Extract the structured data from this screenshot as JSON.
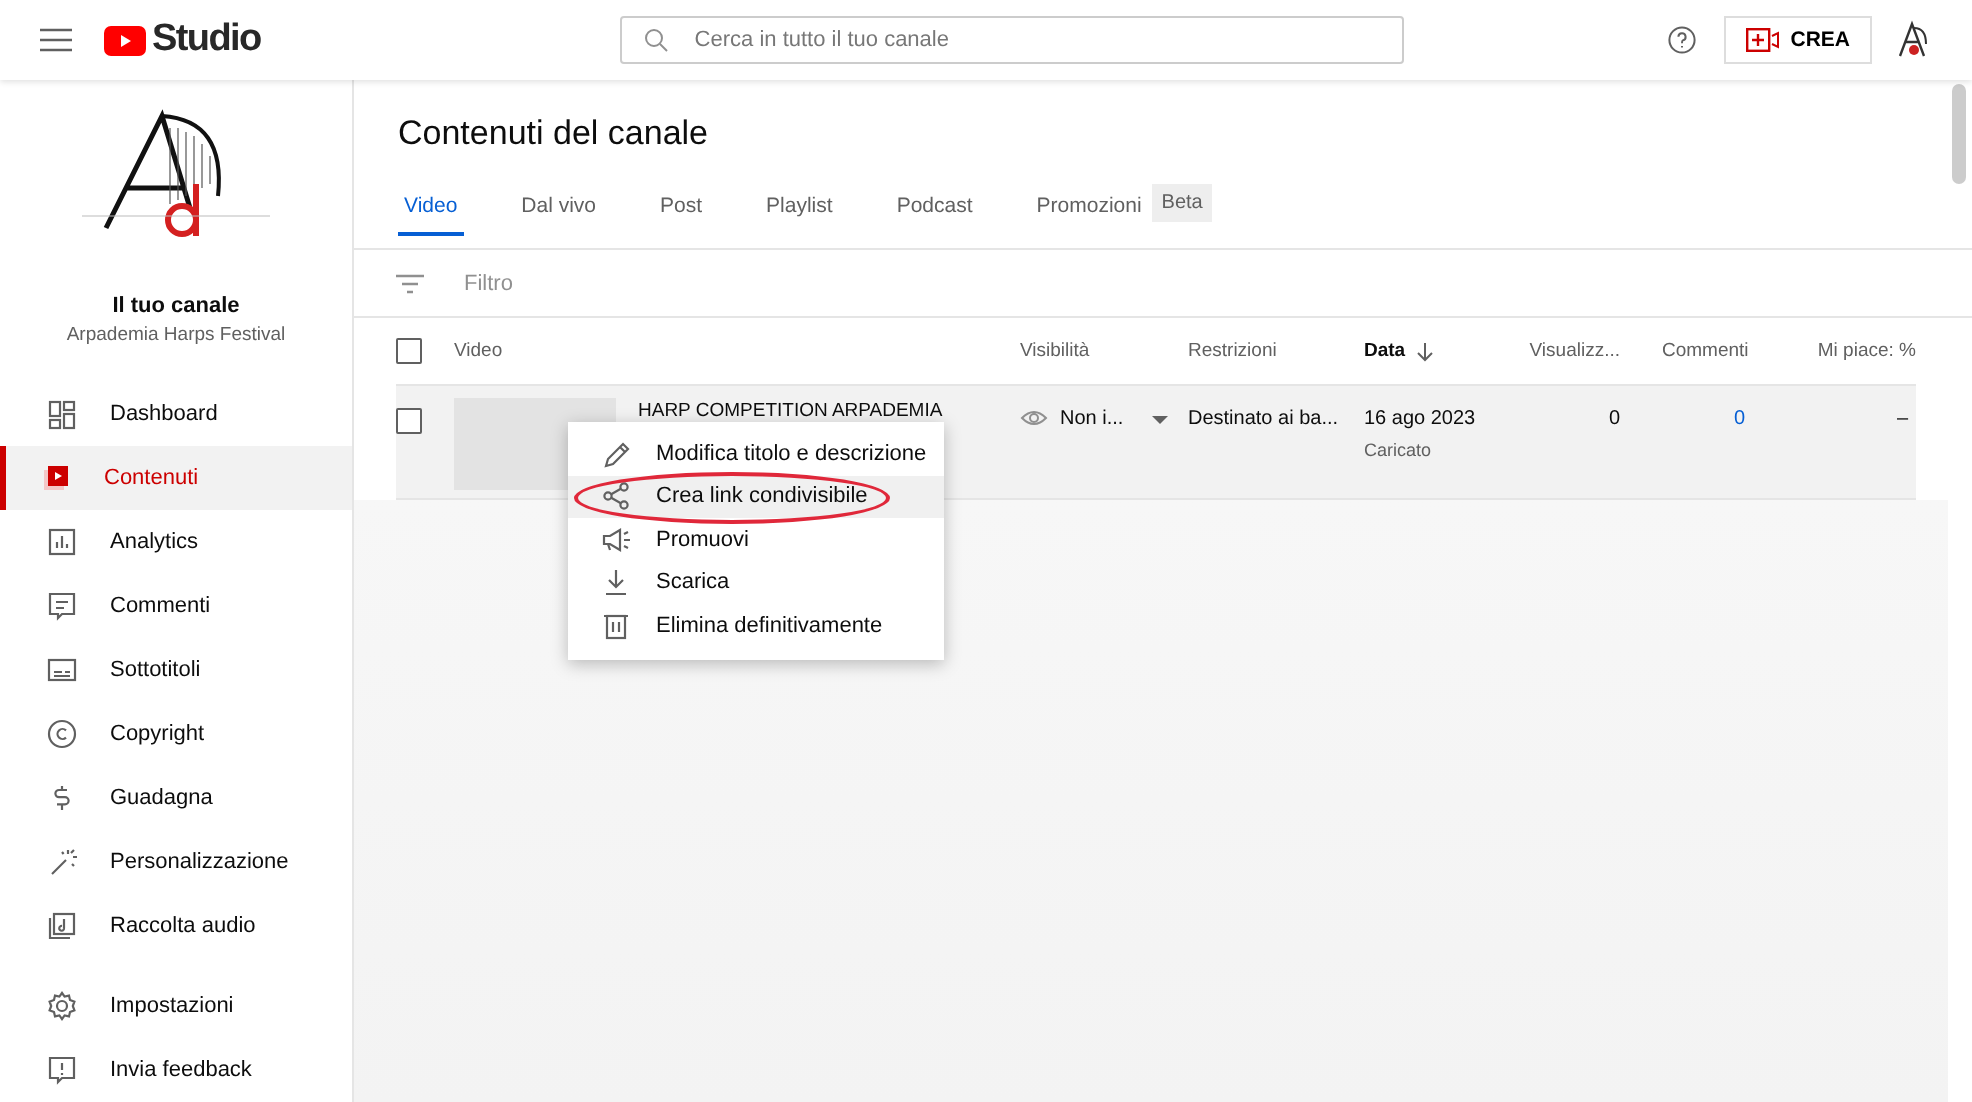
{
  "topbar": {
    "logo_text": "Studio",
    "search": {
      "placeholder": "Cerca in tutto il tuo canale"
    },
    "create_button": "CREA"
  },
  "sidebar": {
    "channel_title": "Il tuo canale",
    "channel_name": "Arpademia Harps Festival",
    "items": [
      {
        "label": "Dashboard",
        "kind": "dashboard",
        "selected": false
      },
      {
        "label": "Contenuti",
        "kind": "content",
        "selected": true
      },
      {
        "label": "Analytics",
        "kind": "analytics",
        "selected": false
      },
      {
        "label": "Commenti",
        "kind": "comments",
        "selected": false
      },
      {
        "label": "Sottotitoli",
        "kind": "subtitles",
        "selected": false
      },
      {
        "label": "Copyright",
        "kind": "copyright",
        "selected": false
      },
      {
        "label": "Guadagna",
        "kind": "dollar",
        "selected": false
      },
      {
        "label": "Personalizzazione",
        "kind": "wand",
        "selected": false
      },
      {
        "label": "Raccolta audio",
        "kind": "audio",
        "selected": false
      }
    ],
    "footer_items": [
      {
        "label": "Impostazioni",
        "kind": "settings",
        "selected": false
      },
      {
        "label": "Invia feedback",
        "kind": "feedback",
        "selected": false
      }
    ]
  },
  "page_title": "Contenuti del canale",
  "tabs": [
    {
      "label": "Video",
      "selected": true
    },
    {
      "label": "Dal vivo",
      "selected": false
    },
    {
      "label": "Post",
      "selected": false
    },
    {
      "label": "Playlist",
      "selected": false
    },
    {
      "label": "Podcast",
      "selected": false
    },
    {
      "label": "Promozioni",
      "badge": "Beta",
      "selected": false
    }
  ],
  "filter": {
    "placeholder": "Filtro"
  },
  "table": {
    "select_all_checked": false,
    "columns": [
      {
        "label": "Video",
        "sorted": false
      },
      {
        "label": "Visibilità",
        "sorted": false
      },
      {
        "label": "Restrizioni",
        "sorted": false
      },
      {
        "label": "Data",
        "sorted": true
      },
      {
        "label": "Visualizz...",
        "sorted": false
      },
      {
        "label": "Commenti",
        "sorted": false
      },
      {
        "label": "Mi piace: %",
        "sorted": false
      }
    ],
    "rows": [
      {
        "checked": false,
        "title": "HARP COMPETITION ARPADEMIA",
        "visibility": "Non i...",
        "restrictions": "Destinato ai ba...",
        "date": "16 ago 2023",
        "date_status": "Caricato",
        "views": "0",
        "comments": "0",
        "likes": "–"
      }
    ]
  },
  "context_menu": {
    "items": [
      {
        "label": "Modifica titolo e descrizione",
        "kind": "pencil",
        "highlighted": false,
        "circled": false
      },
      {
        "label": "Crea link condivisibile",
        "kind": "share",
        "highlighted": true,
        "circled": true
      },
      {
        "label": "Promuovi",
        "kind": "megaphone",
        "highlighted": false,
        "circled": false
      },
      {
        "label": "Scarica",
        "kind": "download",
        "highlighted": false,
        "circled": false
      },
      {
        "label": "Elimina definitivamente",
        "kind": "trash",
        "highlighted": false,
        "circled": false
      }
    ]
  }
}
